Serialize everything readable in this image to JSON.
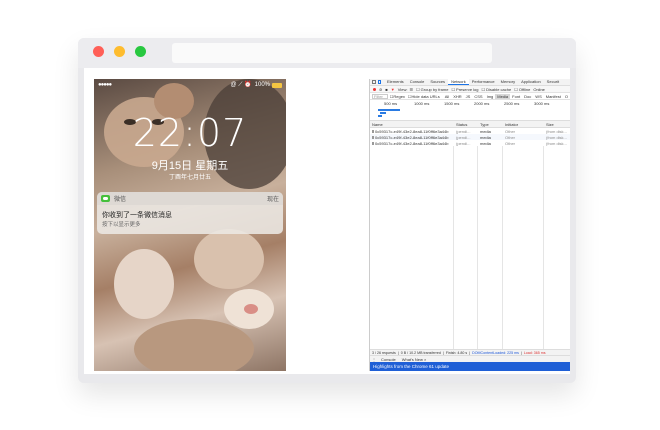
{
  "browser": {
    "traffic_lights": [
      "#ff5f57",
      "#febc2e",
      "#28c840"
    ]
  },
  "phone": {
    "status": {
      "signal": "●●●●●",
      "right_icons": "@ ⟋ ⏰",
      "battery": "100%"
    },
    "time": "22:07",
    "date": "9月15日 星期五",
    "lunar": "丁酉年七月廿五",
    "notification": {
      "app": "微信",
      "when": "现在",
      "message": "你收到了一条微信消息",
      "hint": "按下以显示更多"
    }
  },
  "devtools": {
    "tabs": [
      "Elements",
      "Console",
      "Sources",
      "Network",
      "Performance",
      "Memory",
      "Application",
      "Securit"
    ],
    "active_tab": "Network",
    "toolbar": {
      "view": "View:",
      "group_by_frame": "Group by frame",
      "preserve_log": "Preserve log",
      "disable_cache": "Disable cache",
      "offline": "Offline",
      "online": "Online"
    },
    "filter": {
      "placeholder": "Filter",
      "regex": "Regex",
      "hide_data_urls": "Hide data URLs",
      "types": [
        "All",
        "XHR",
        "JS",
        "CSS",
        "Img",
        "Media",
        "Font",
        "Doc",
        "WS",
        "Manifest",
        "O"
      ]
    },
    "timeline_labels": [
      "500 ms",
      "1000 ms",
      "1500 ms",
      "2000 ms",
      "2500 ms",
      "3000 ms"
    ],
    "columns": [
      "Name",
      "Status",
      "Type",
      "Initiator",
      "Size"
    ],
    "rows": [
      {
        "name": "0c59317c-e49f-43e2-8ea8-11f0ff6e3a44b",
        "status": "(pendi...",
        "type": "media",
        "initiator": "Other",
        "size": "(from disk..."
      },
      {
        "name": "0c59317c-e49f-43e2-8ea8-11f0ff6e3a44b",
        "status": "(pendi...",
        "type": "media",
        "initiator": "Other",
        "size": "(from disk..."
      },
      {
        "name": "0c59317c-e49f-43e2-8ea8-11f0ff6e3a44b",
        "status": "(pendi...",
        "type": "media",
        "initiator": "Other",
        "size": "(from disk..."
      }
    ],
    "summary": {
      "requests": "3 / 26 requests",
      "transferred": "0 B / 10.2 MB transferred",
      "finish": "Finish: 4.80 s",
      "dom": "DOMContentLoaded: 225 ms",
      "load": "Load: 365 ms"
    },
    "drawer_tabs": [
      "Console",
      "What's New ×"
    ],
    "banner": "Highlights from the Chrome 61 update"
  }
}
